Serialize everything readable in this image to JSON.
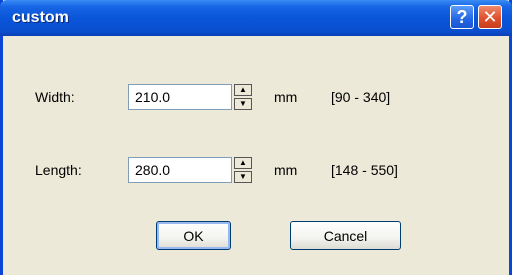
{
  "dialog": {
    "title": "custom",
    "help_label": "?",
    "close_label": "✕"
  },
  "width": {
    "label": "Width:",
    "value": "210.0",
    "unit": "mm",
    "range": "[90 - 340]"
  },
  "length": {
    "label": "Length:",
    "value": "280.0",
    "unit": "mm",
    "range": "[148 - 550]"
  },
  "buttons": {
    "ok": "OK",
    "cancel": "Cancel"
  },
  "spinner_icons": {
    "up": "▲",
    "down": "▼"
  },
  "colors": {
    "titlebar": "#0a55d9",
    "close_button": "#e0522f",
    "dialog_background": "#ece9d8"
  }
}
